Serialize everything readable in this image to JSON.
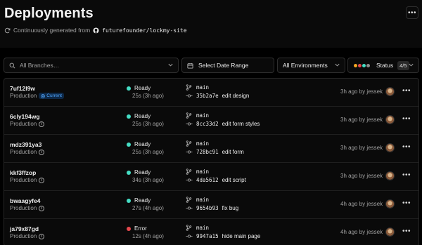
{
  "page": {
    "title": "Deployments",
    "subtitle_prefix": "Continuously generated from",
    "repo": "futurefounder/lockmy-site"
  },
  "filters": {
    "branch_placeholder": "All Branches…",
    "date_label": "Select Date Range",
    "environment_label": "All Environments",
    "status_label": "Status",
    "status_count": "4/5",
    "status_colors": [
      "#f5a623",
      "#e5484d",
      "#45dec5",
      "#8f8f8f"
    ]
  },
  "colors": {
    "ready": "#45dec5",
    "error": "#e5484d",
    "current_badge": "#52a8ff"
  },
  "deployments": [
    {
      "id": "7uf12l9w",
      "environment": "Production",
      "current_label": "Current",
      "status": "Ready",
      "status_color": "#45dec5",
      "duration": "25s (3h ago)",
      "branch": "main",
      "hash": "35b2a7e",
      "message": "edit design",
      "when": "3h ago by jessek"
    },
    {
      "id": "6cly194wg",
      "environment": "Production",
      "status": "Ready",
      "status_color": "#45dec5",
      "duration": "25s (3h ago)",
      "branch": "main",
      "hash": "8cc33d2",
      "message": "edit form styles",
      "when": "3h ago by jessek"
    },
    {
      "id": "mdz391ya3",
      "environment": "Production",
      "status": "Ready",
      "status_color": "#45dec5",
      "duration": "25s (3h ago)",
      "branch": "main",
      "hash": "728bc91",
      "message": "edit form",
      "when": "3h ago by jessek"
    },
    {
      "id": "kkf3ffzop",
      "environment": "Production",
      "status": "Ready",
      "status_color": "#45dec5",
      "duration": "34s (3h ago)",
      "branch": "main",
      "hash": "4da5612",
      "message": "edit script",
      "when": "3h ago by jessek"
    },
    {
      "id": "bwaagyfe4",
      "environment": "Production",
      "status": "Ready",
      "status_color": "#45dec5",
      "duration": "27s (4h ago)",
      "branch": "main",
      "hash": "9654b93",
      "message": "fix bug",
      "when": "4h ago by jessek"
    },
    {
      "id": "ja79x87gd",
      "environment": "Production",
      "status": "Error",
      "status_color": "#e5484d",
      "duration": "12s (4h ago)",
      "branch": "main",
      "hash": "9947a15",
      "message": "hide main page",
      "when": "4h ago by jessek"
    }
  ]
}
